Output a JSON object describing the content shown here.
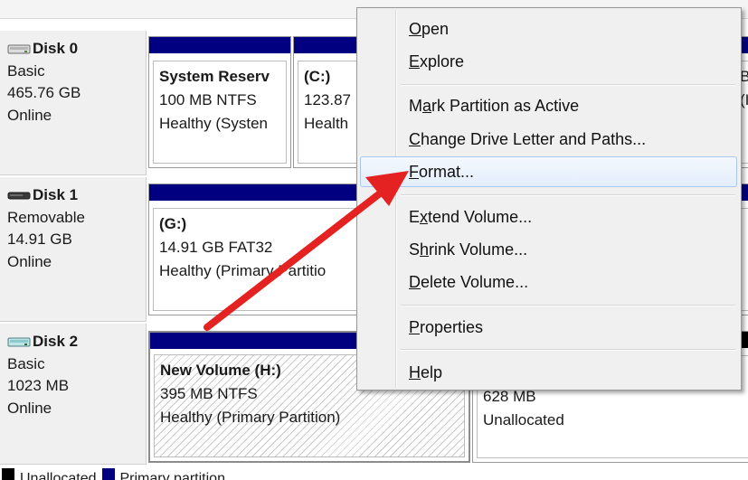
{
  "disks": [
    {
      "name": "Disk 0",
      "type": "Basic",
      "size": "465.76 GB",
      "status": "Online",
      "icon": "hard-disk-icon"
    },
    {
      "name": "Disk 1",
      "type": "Removable",
      "size": "14.91 GB",
      "status": "Online",
      "icon": "removable-disk-icon"
    },
    {
      "name": "Disk 2",
      "type": "Basic",
      "size": "1023 MB",
      "status": "Online",
      "icon": "hard-disk-icon"
    }
  ],
  "partitions": {
    "disk0": [
      {
        "title": "System Reserv",
        "size": "100 MB NTFS",
        "status": "Healthy (Systen"
      },
      {
        "title": "(C:)",
        "size": "123.87",
        "status": "Health"
      },
      {
        "title": "",
        "size": "B",
        "status": "(I"
      }
    ],
    "disk1": [
      {
        "title": "(G:)",
        "size": "14.91 GB FAT32",
        "status": "Healthy (Primary Partitio"
      }
    ],
    "disk2": [
      {
        "title": "New Volume  (H:)",
        "size": "395 MB NTFS",
        "status": "Healthy (Primary Partition)"
      },
      {
        "title": "",
        "size": "628 MB",
        "status": "Unallocated"
      }
    ]
  },
  "context_menu": {
    "items": [
      {
        "pre": "",
        "key": "O",
        "post": "pen"
      },
      {
        "pre": "",
        "key": "E",
        "post": "xplore"
      },
      {
        "pre": "M",
        "key": "a",
        "post": "rk Partition as Active"
      },
      {
        "pre": "",
        "key": "C",
        "post": "hange Drive Letter and Paths..."
      },
      {
        "pre": "",
        "key": "F",
        "post": "ormat..."
      },
      {
        "pre": "E",
        "key": "x",
        "post": "tend Volume..."
      },
      {
        "pre": "S",
        "key": "h",
        "post": "rink Volume..."
      },
      {
        "pre": "",
        "key": "D",
        "post": "elete Volume..."
      },
      {
        "pre": "",
        "key": "P",
        "post": "roperties"
      },
      {
        "pre": "",
        "key": "H",
        "post": "elp"
      }
    ]
  },
  "legend": {
    "items": [
      {
        "label": "Unallocated",
        "color": "#000000"
      },
      {
        "label": "Primary partition",
        "color": "#000080"
      }
    ]
  },
  "colors": {
    "primary_bar": "#000080",
    "arrow": "#e52222",
    "menu_highlight_border": "#a9c8ec"
  }
}
